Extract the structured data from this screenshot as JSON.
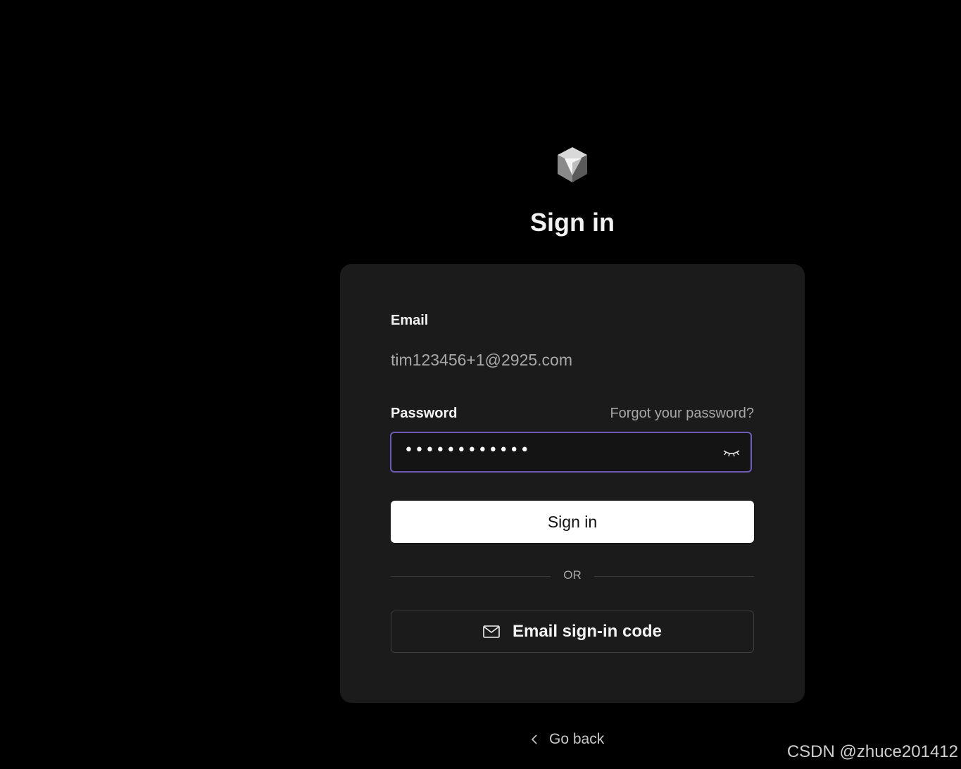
{
  "header": {
    "logo_icon": "cube-logo-icon",
    "title": "Sign in"
  },
  "form": {
    "email_label": "Email",
    "email_value": "tim123456+1@2925.com",
    "password_label": "Password",
    "forgot_link": "Forgot your password?",
    "password_masked": "••••••••••••",
    "password_toggle_icon": "eye-closed-icon",
    "signin_button": "Sign in",
    "divider_text": "OR",
    "email_code_button": "Email sign-in code",
    "email_code_icon": "mail-icon"
  },
  "footer": {
    "go_back": "Go back",
    "go_back_icon": "chevron-left-icon"
  },
  "watermark": "CSDN @zhuce201412",
  "colors": {
    "background": "#000000",
    "card": "#1b1b1b",
    "focus_border": "#6e5bb5",
    "primary_button": "#ffffff"
  }
}
